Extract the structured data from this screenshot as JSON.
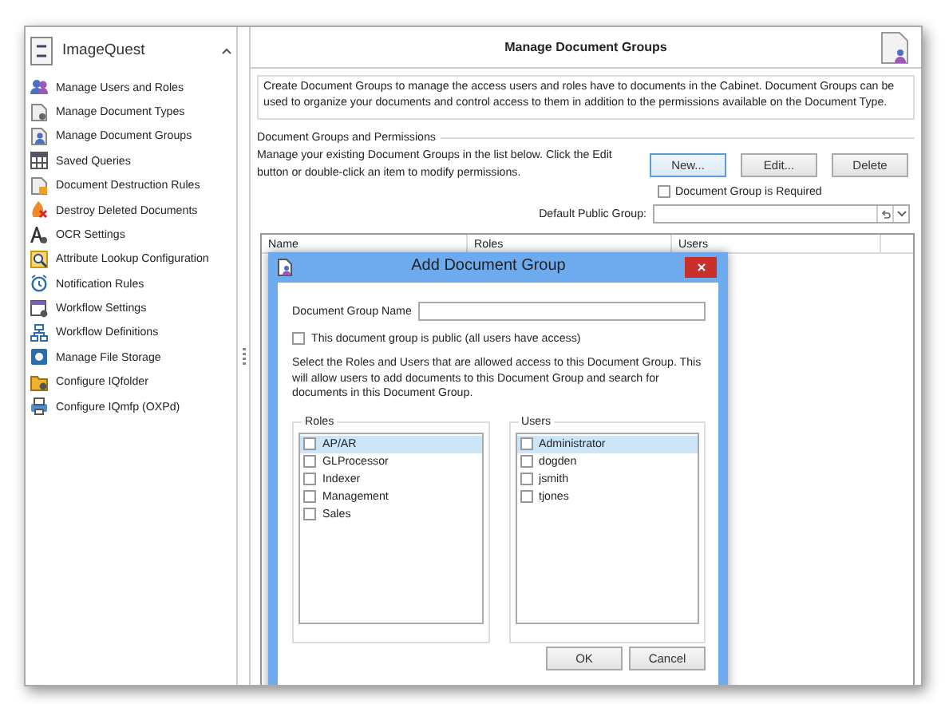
{
  "sidebar": {
    "title": "ImageQuest",
    "expanded": true,
    "items": [
      {
        "label": "Manage Users and Roles"
      },
      {
        "label": "Manage Document Types"
      },
      {
        "label": "Manage Document Groups"
      },
      {
        "label": "Saved Queries"
      },
      {
        "label": "Document Destruction Rules"
      },
      {
        "label": "Destroy Deleted Documents"
      },
      {
        "label": "OCR Settings"
      },
      {
        "label": "Attribute Lookup Configuration"
      },
      {
        "label": "Notification Rules"
      },
      {
        "label": "Workflow Settings"
      },
      {
        "label": "Workflow Definitions"
      },
      {
        "label": "Manage File Storage"
      },
      {
        "label": "Configure IQfolder"
      },
      {
        "label": "Configure IQmfp (OXPd)"
      }
    ]
  },
  "main": {
    "title": "Manage Document Groups",
    "description": "Create Document Groups to manage the access users and roles have to documents in the Cabinet.  Document Groups can be used to organize your documents and control access to them in addition to the permissions available on the Document Type.",
    "group": {
      "legend": "Document Groups and Permissions",
      "hint": "Manage your existing Document Groups in the list below.  Click the Edit button or double-click an item to modify permissions.",
      "buttons": [
        {
          "label": "New...",
          "focused": true
        },
        {
          "label": "Edit...",
          "focused": false
        },
        {
          "label": "Delete",
          "focused": false
        }
      ],
      "required_checkbox": {
        "label": "Document Group is Required",
        "checked": false
      },
      "default_group_label": "Default Public Group:",
      "table": {
        "columns": [
          "Name",
          "Roles",
          "Users"
        ]
      }
    }
  },
  "dialog": {
    "title": "Add Document Group",
    "name_label": "Document Group Name",
    "public_checkbox": {
      "label": "This document group is public (all users have access)",
      "checked": false
    },
    "instructions": "Select the Roles and Users that are allowed access to this Document Group.  This will allow users to add documents to this Document Group and search for documents in this Document Group.",
    "lists": [
      {
        "legend": "Roles",
        "items": [
          {
            "label": "AP/AR",
            "checked": false,
            "selected": true
          },
          {
            "label": "GLProcessor",
            "checked": false,
            "selected": false
          },
          {
            "label": "Indexer",
            "checked": false,
            "selected": false
          },
          {
            "label": "Management",
            "checked": false,
            "selected": false
          },
          {
            "label": "Sales",
            "checked": false,
            "selected": false
          }
        ]
      },
      {
        "legend": "Users",
        "items": [
          {
            "label": "Administrator",
            "checked": false,
            "selected": true
          },
          {
            "label": "dogden",
            "checked": false,
            "selected": false
          },
          {
            "label": "jsmith",
            "checked": false,
            "selected": false
          },
          {
            "label": "tjones",
            "checked": false,
            "selected": false
          }
        ]
      }
    ],
    "buttons": [
      "OK",
      "Cancel"
    ]
  }
}
